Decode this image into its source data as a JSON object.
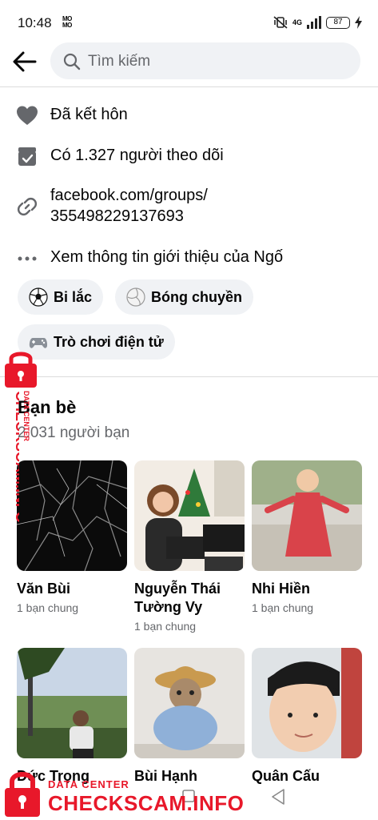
{
  "status_bar": {
    "time": "10:48",
    "carrier_label": "MO MO",
    "network": "4G",
    "battery": "87"
  },
  "search": {
    "placeholder": "Tìm kiếm"
  },
  "intro": {
    "relationship": "Đã kết hôn",
    "followers": "Có 1.327 người theo dõi",
    "link_line1": "facebook.com/groups/",
    "link_line2": "355498229137693",
    "see_more": "Xem thông tin giới thiệu của Ngố"
  },
  "hobbies": [
    {
      "label": "Bi lắc",
      "icon": "soccer-ball-icon"
    },
    {
      "label": "Bóng chuyền",
      "icon": "volleyball-icon"
    },
    {
      "label": "Trò chơi điện tử",
      "icon": "gamepad-icon"
    }
  ],
  "friends": {
    "title": "Bạn bè",
    "count": "2.031 người bạn",
    "list": [
      {
        "name": "Văn Bùi",
        "mutual": "1 bạn chung"
      },
      {
        "name": "Nguyễn Thái Tường Vy",
        "mutual": "1 bạn chung"
      },
      {
        "name": "Nhi Hiền",
        "mutual": "1 bạn chung"
      },
      {
        "name": "Đức Trọng",
        "mutual": ""
      },
      {
        "name": "Bùi Hạnh",
        "mutual": ""
      },
      {
        "name": "Quân Cấu",
        "mutual": ""
      }
    ]
  },
  "watermark": {
    "data_center": "DATA CENTER",
    "brand": "CHECKSCAM.INFO"
  },
  "colors": {
    "accent": "#e8182a",
    "chip_bg": "#f0f2f5",
    "secondary_text": "#65676b"
  }
}
